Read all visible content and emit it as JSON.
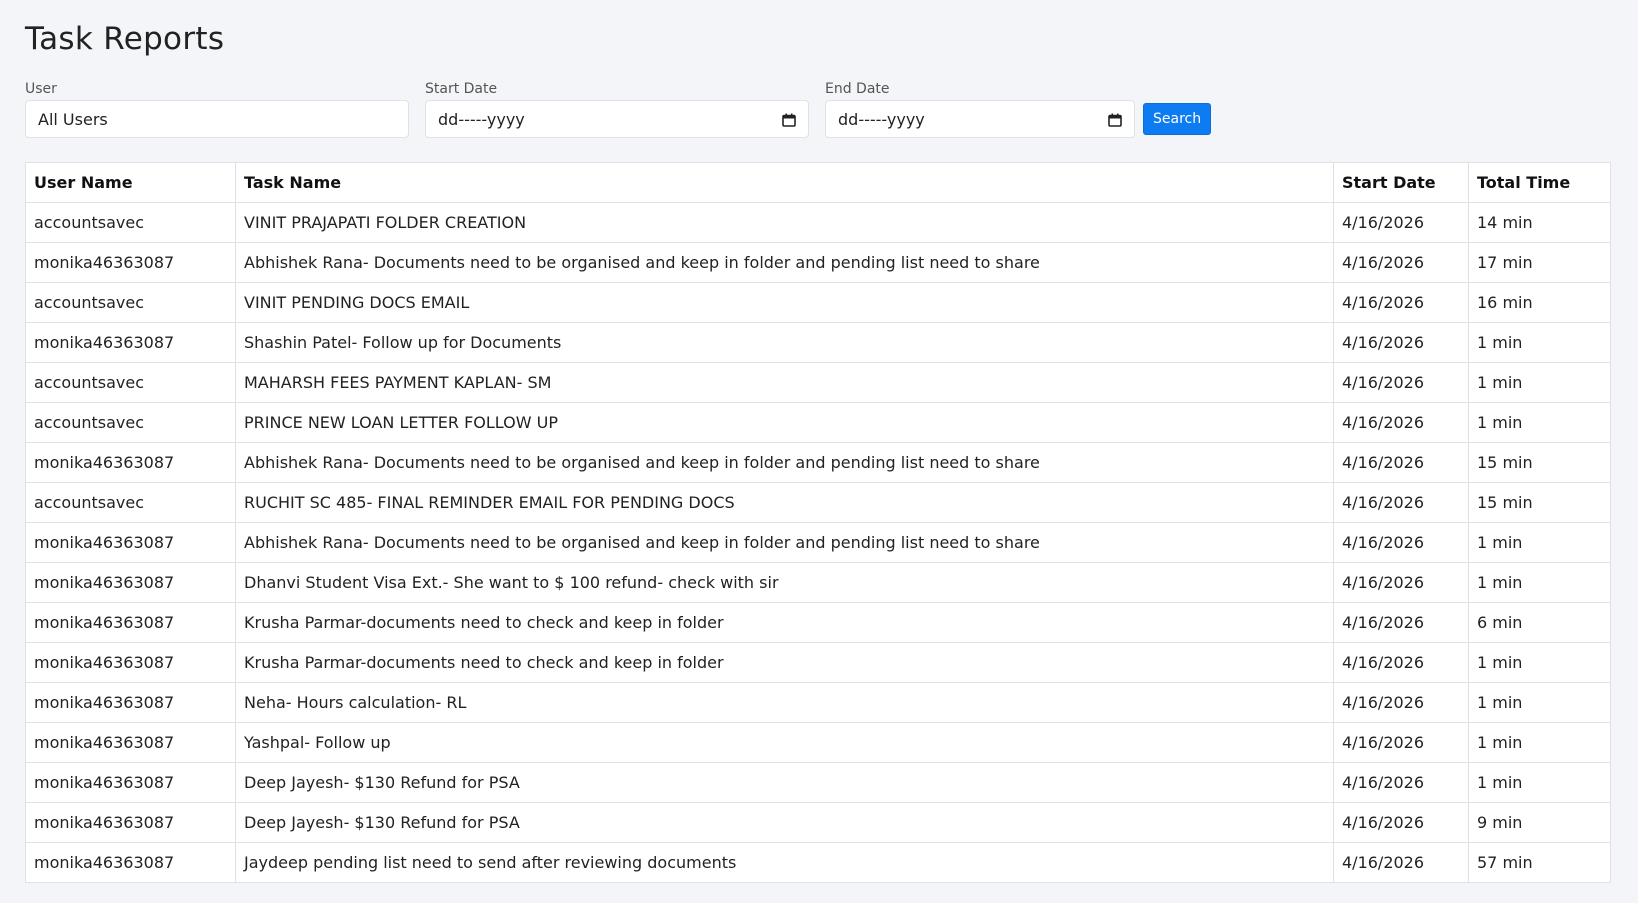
{
  "page": {
    "title": "Task Reports"
  },
  "filters": {
    "user_label": "User",
    "user_value": "All Users",
    "start_label": "Start Date",
    "start_value": "dd-----yyyy",
    "end_label": "End Date",
    "end_value": "dd-----yyyy",
    "search_label": "Search"
  },
  "table": {
    "headers": [
      "User Name",
      "Task Name",
      "Start Date",
      "Total Time"
    ],
    "rows": [
      [
        "accountsavec",
        "VINIT PRAJAPATI FOLDER CREATION",
        "4/16/2026",
        "14 min"
      ],
      [
        "monika46363087",
        "Abhishek Rana- Documents need to be organised and keep in folder and pending list need to share",
        "4/16/2026",
        "17 min"
      ],
      [
        "accountsavec",
        "VINIT PENDING DOCS EMAIL",
        "4/16/2026",
        "16 min"
      ],
      [
        "monika46363087",
        "Shashin Patel- Follow up for Documents",
        "4/16/2026",
        "1 min"
      ],
      [
        "accountsavec",
        "MAHARSH FEES PAYMENT KAPLAN- SM",
        "4/16/2026",
        "1 min"
      ],
      [
        "accountsavec",
        "PRINCE NEW LOAN LETTER FOLLOW UP",
        "4/16/2026",
        "1 min"
      ],
      [
        "monika46363087",
        "Abhishek Rana- Documents need to be organised and keep in folder and pending list need to share",
        "4/16/2026",
        "15 min"
      ],
      [
        "accountsavec",
        "RUCHIT SC 485- FINAL REMINDER EMAIL FOR PENDING DOCS",
        "4/16/2026",
        "15 min"
      ],
      [
        "monika46363087",
        "Abhishek Rana- Documents need to be organised and keep in folder and pending list need to share",
        "4/16/2026",
        "1 min"
      ],
      [
        "monika46363087",
        "Dhanvi Student Visa Ext.- She want to $ 100 refund- check with sir",
        "4/16/2026",
        "1 min"
      ],
      [
        "monika46363087",
        "Krusha Parmar-documents need to check and keep in folder",
        "4/16/2026",
        "6 min"
      ],
      [
        "monika46363087",
        "Krusha Parmar-documents need to check and keep in folder",
        "4/16/2026",
        "1 min"
      ],
      [
        "monika46363087",
        "Neha- Hours calculation- RL",
        "4/16/2026",
        "1 min"
      ],
      [
        "monika46363087",
        "Yashpal- Follow up",
        "4/16/2026",
        "1 min"
      ],
      [
        "monika46363087",
        "Deep Jayesh- $130 Refund for PSA",
        "4/16/2026",
        "1 min"
      ],
      [
        "monika46363087",
        "Deep Jayesh- $130 Refund for PSA",
        "4/16/2026",
        "9 min"
      ],
      [
        "monika46363087",
        "Jaydeep pending list need to send after reviewing documents",
        "4/16/2026",
        "57 min"
      ]
    ]
  },
  "icons": {
    "date_picker": "calendar-icon"
  },
  "colors": {
    "accent": "#0d7cf2",
    "background": "#f4f5f9",
    "border": "#dee2e6"
  }
}
